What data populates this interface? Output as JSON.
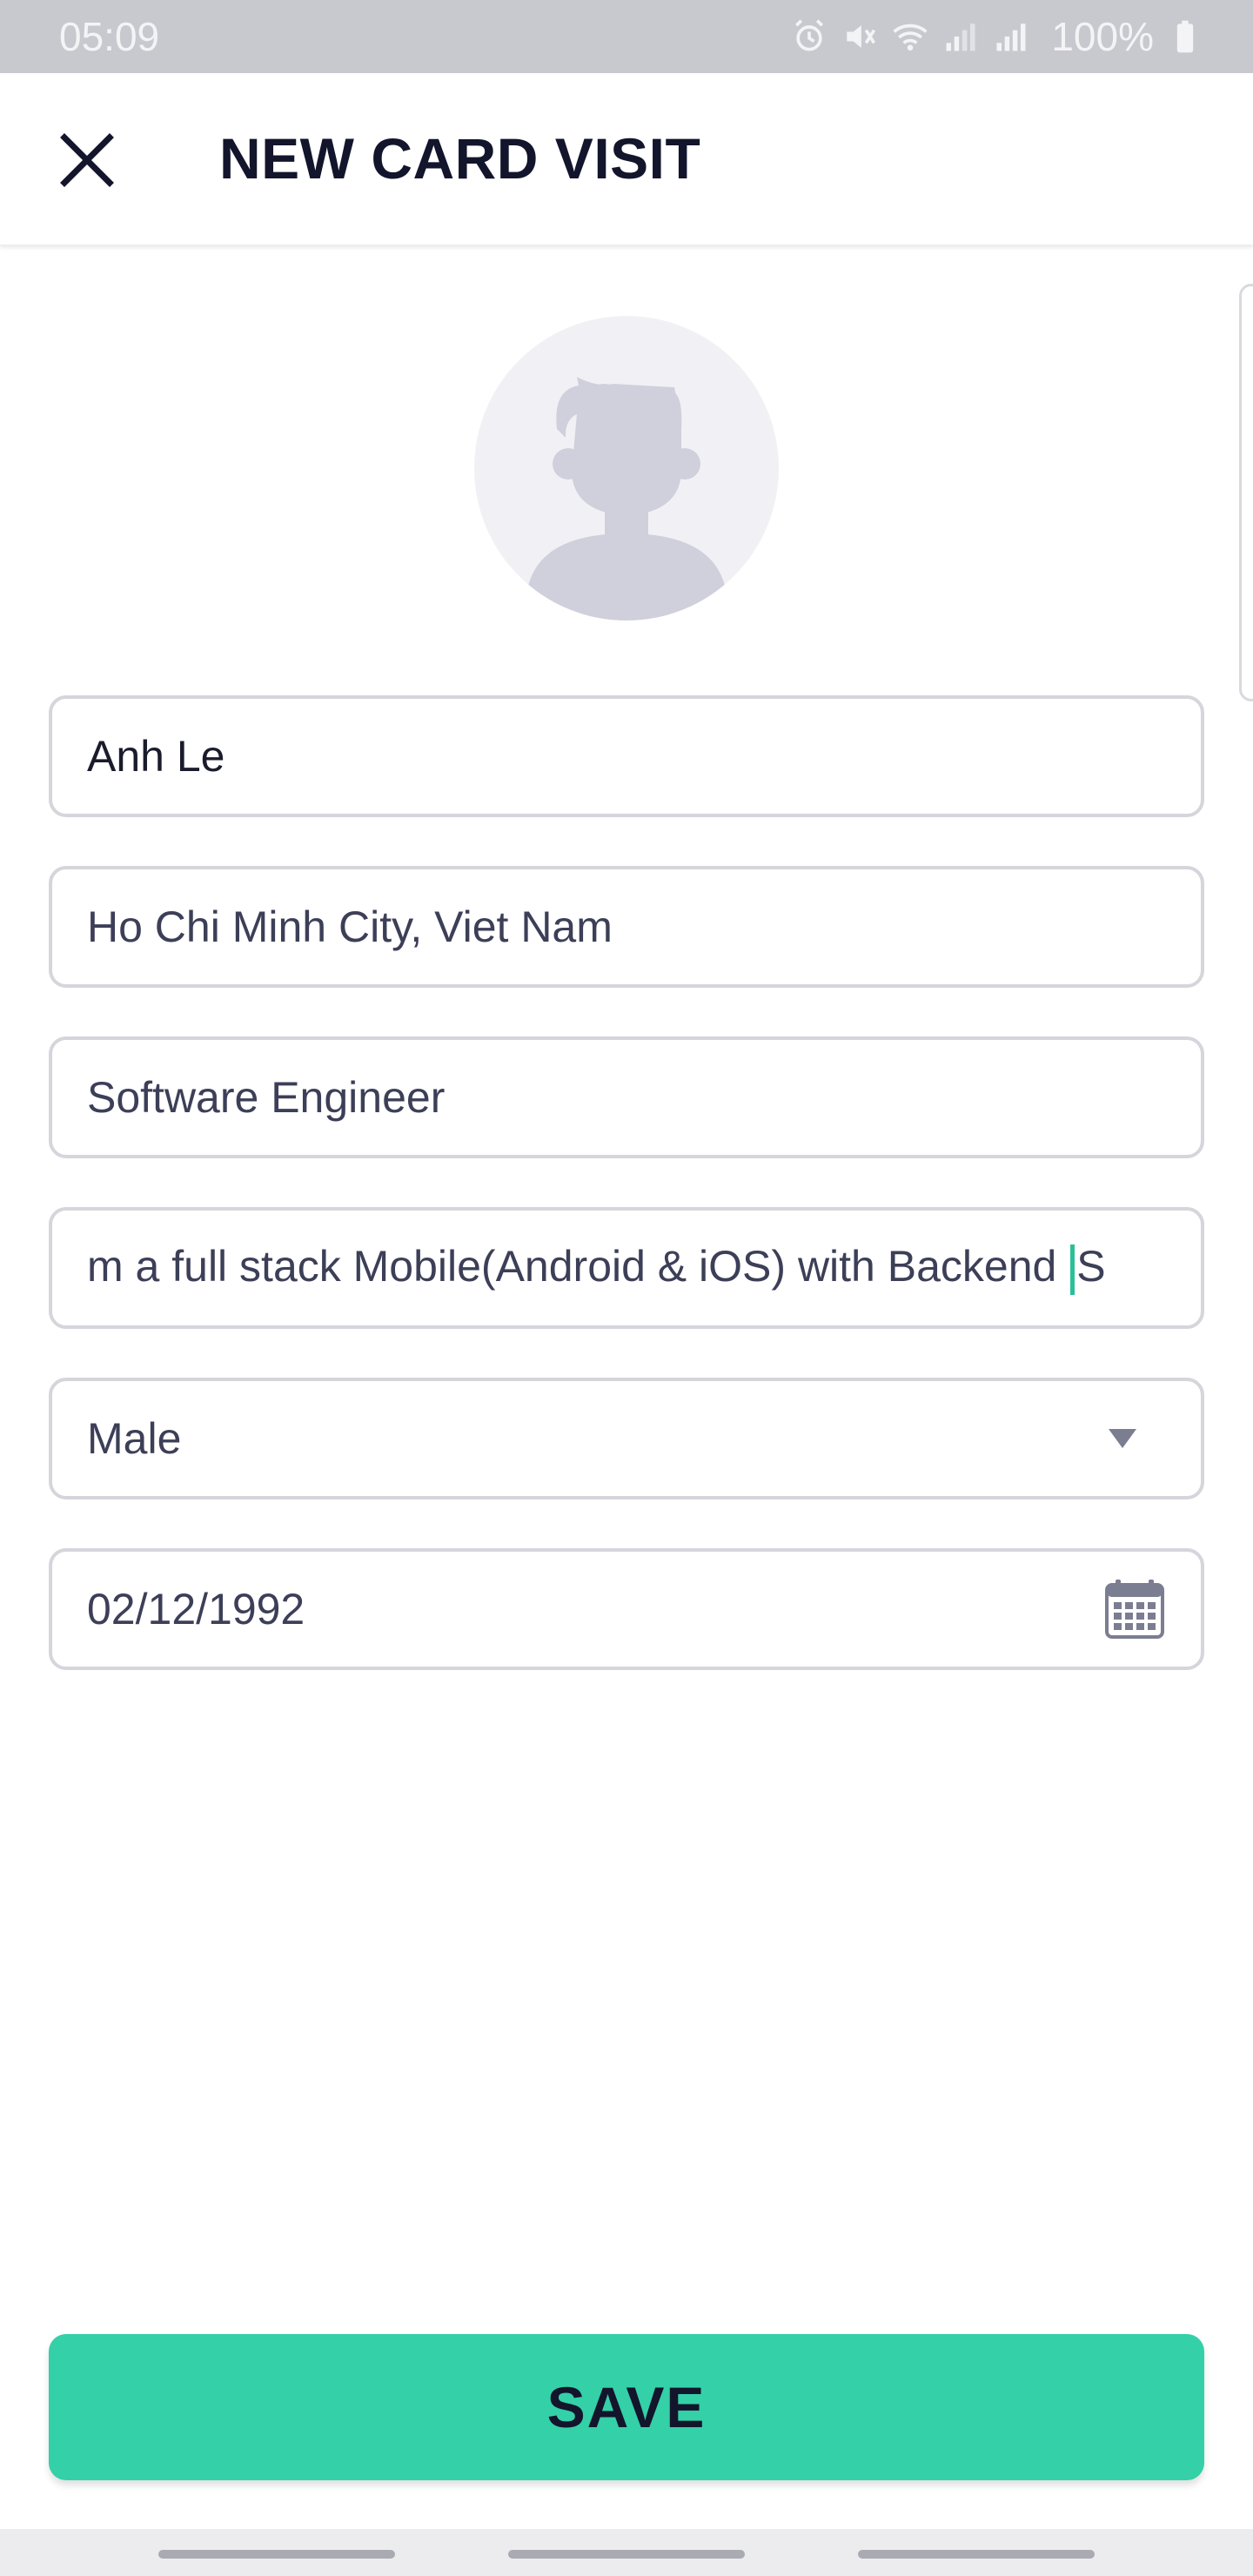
{
  "status_bar": {
    "time": "05:09",
    "battery_percent": "100%",
    "icons": [
      "alarm-icon",
      "mute-icon",
      "wifi-icon",
      "signal-icon",
      "signal-icon",
      "battery-icon"
    ]
  },
  "header": {
    "title": "NEW CARD VISIT",
    "close_icon": "close-icon"
  },
  "avatar": {
    "icon": "user-placeholder-icon"
  },
  "form": {
    "name": "Anh Le",
    "address": "Ho Chi Minh City, Viet Nam",
    "job_title": "Software Engineer",
    "bio_before_caret": "m a full stack Mobile(Android & iOS) with Backend ",
    "bio_after_caret": "S",
    "gender": "Male",
    "birthday": "02/12/1992"
  },
  "actions": {
    "save_label": "SAVE"
  },
  "colors": {
    "accent": "#34d0a8",
    "caret": "#2bbf97",
    "title": "#12152b",
    "border": "#d5d5dc"
  }
}
